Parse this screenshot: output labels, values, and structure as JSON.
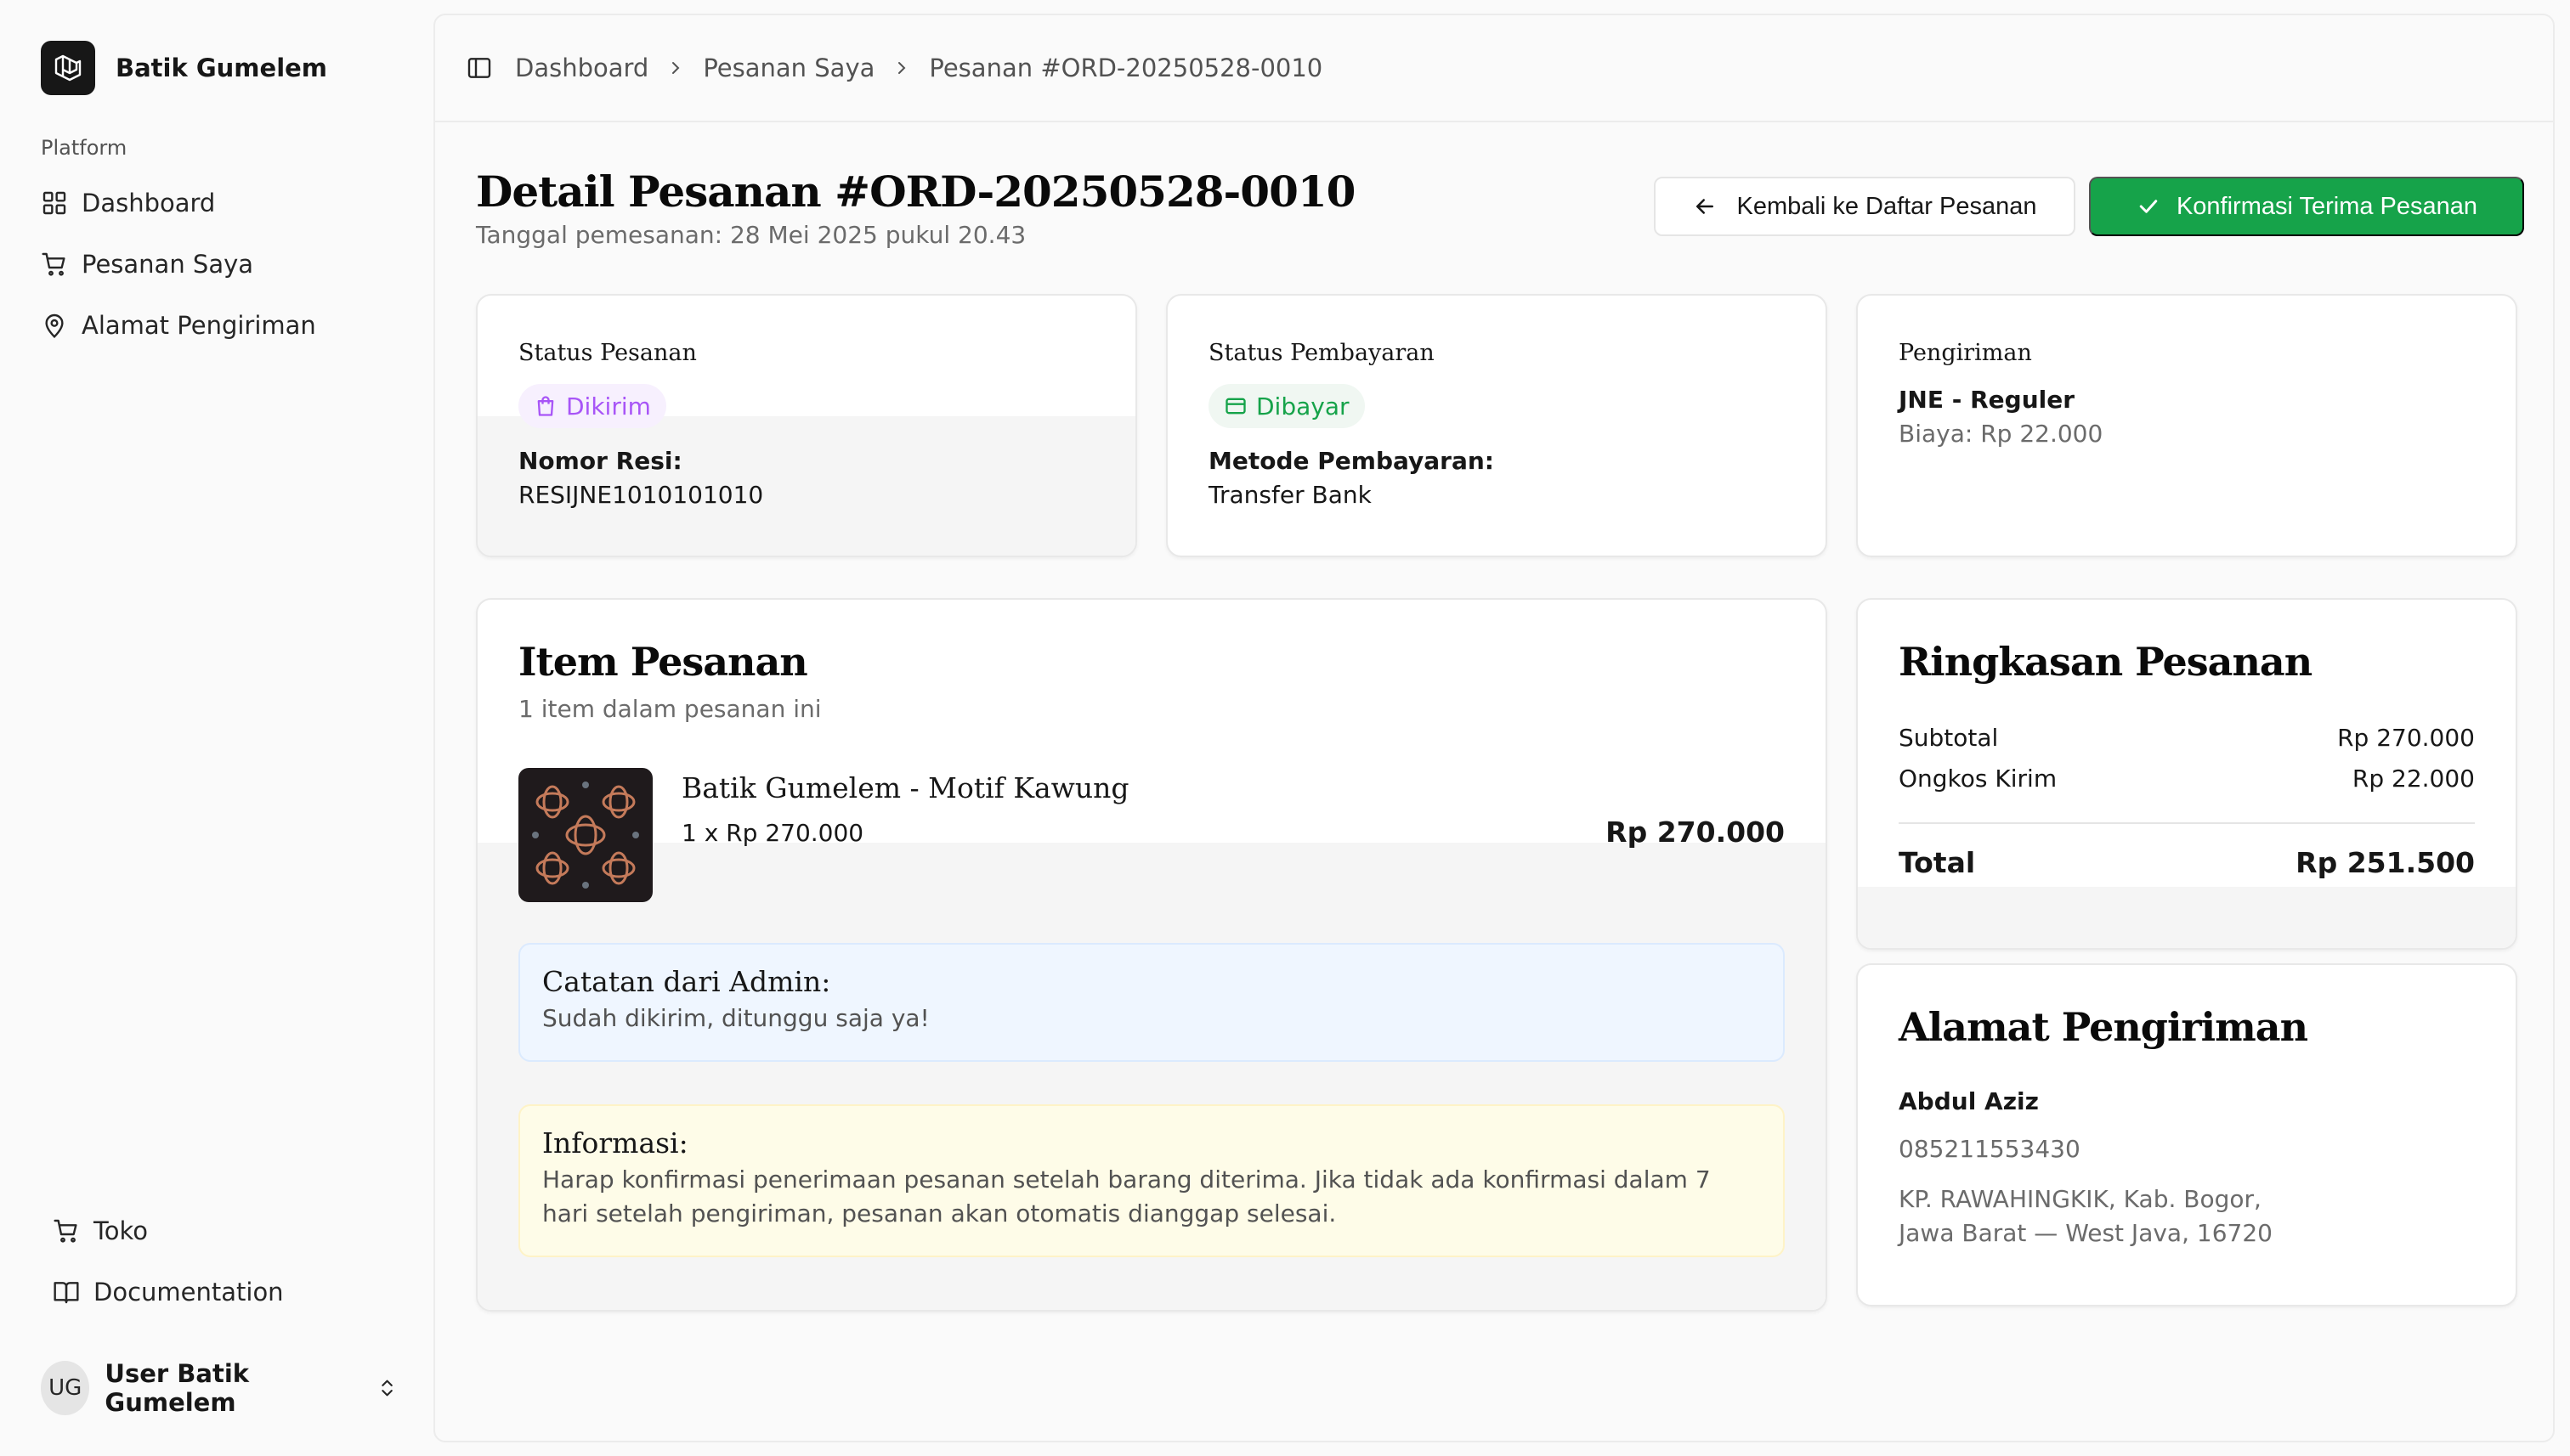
{
  "brand": {
    "name": "Batik Gumelem"
  },
  "sidebar": {
    "group_label": "Platform",
    "items": [
      {
        "label": "Dashboard",
        "icon": "layout-grid-icon"
      },
      {
        "label": "Pesanan Saya",
        "icon": "shopping-cart-icon"
      },
      {
        "label": "Alamat Pengiriman",
        "icon": "map-pin-icon"
      }
    ],
    "footer_items": [
      {
        "label": "Toko",
        "icon": "shopping-cart-icon"
      },
      {
        "label": "Documentation",
        "icon": "book-open-icon"
      }
    ],
    "user": {
      "initials": "UG",
      "name": "User Batik Gumelem"
    }
  },
  "breadcrumb": [
    "Dashboard",
    "Pesanan Saya",
    "Pesanan #ORD-20250528-0010"
  ],
  "page": {
    "title": "Detail Pesanan #ORD-20250528-0010",
    "subtitle": "Tanggal pemesanan: 28 Mei 2025 pukul 20.43",
    "back_button": "Kembali ke Daftar Pesanan",
    "confirm_button": "Konfirmasi Terima Pesanan"
  },
  "status_order": {
    "label": "Status Pesanan",
    "badge": "Dikirim",
    "badge_color": "#a855f7",
    "resi_label": "Nomor Resi:",
    "resi_value": "RESIJNE1010101010"
  },
  "status_payment": {
    "label": "Status Pembayaran",
    "badge": "Dibayar",
    "badge_color": "#16a34a",
    "method_label": "Metode Pembayaran:",
    "method_value": "Transfer Bank"
  },
  "shipping": {
    "label": "Pengiriman",
    "courier": "JNE - Reguler",
    "cost": "Biaya: Rp 22.000"
  },
  "items_section": {
    "title": "Item Pesanan",
    "subtitle": "1 item dalam pesanan ini",
    "items": [
      {
        "name": "Batik Gumelem - Motif Kawung",
        "qty_price": "1 x Rp 270.000",
        "total": "Rp 270.000"
      }
    ]
  },
  "admin_note": {
    "title": "Catatan dari Admin:",
    "body": "Sudah dikirim, ditunggu saja ya!"
  },
  "info_note": {
    "title": "Informasi:",
    "body": "Harap konfirmasi penerimaan pesanan setelah barang diterima. Jika tidak ada konfirmasi dalam 7 hari setelah pengiriman, pesanan akan otomatis dianggap selesai."
  },
  "summary": {
    "title": "Ringkasan Pesanan",
    "subtotal_label": "Subtotal",
    "subtotal_value": "Rp 270.000",
    "shipping_label": "Ongkos Kirim",
    "shipping_value": "Rp 22.000",
    "total_label": "Total",
    "total_value": "Rp 251.500"
  },
  "address": {
    "title": "Alamat Pengiriman",
    "name": "Abdul Aziz",
    "phone": "085211553430",
    "line1": "KP. RAWAHINGKIK, Kab. Bogor,",
    "line2": "Jawa Barat — West Java, 16720"
  },
  "colors": {
    "accent_green": "#16a34a",
    "purple": "#a855f7",
    "note_blue_bg": "#eff6ff",
    "note_yellow_bg": "#fefce8"
  }
}
